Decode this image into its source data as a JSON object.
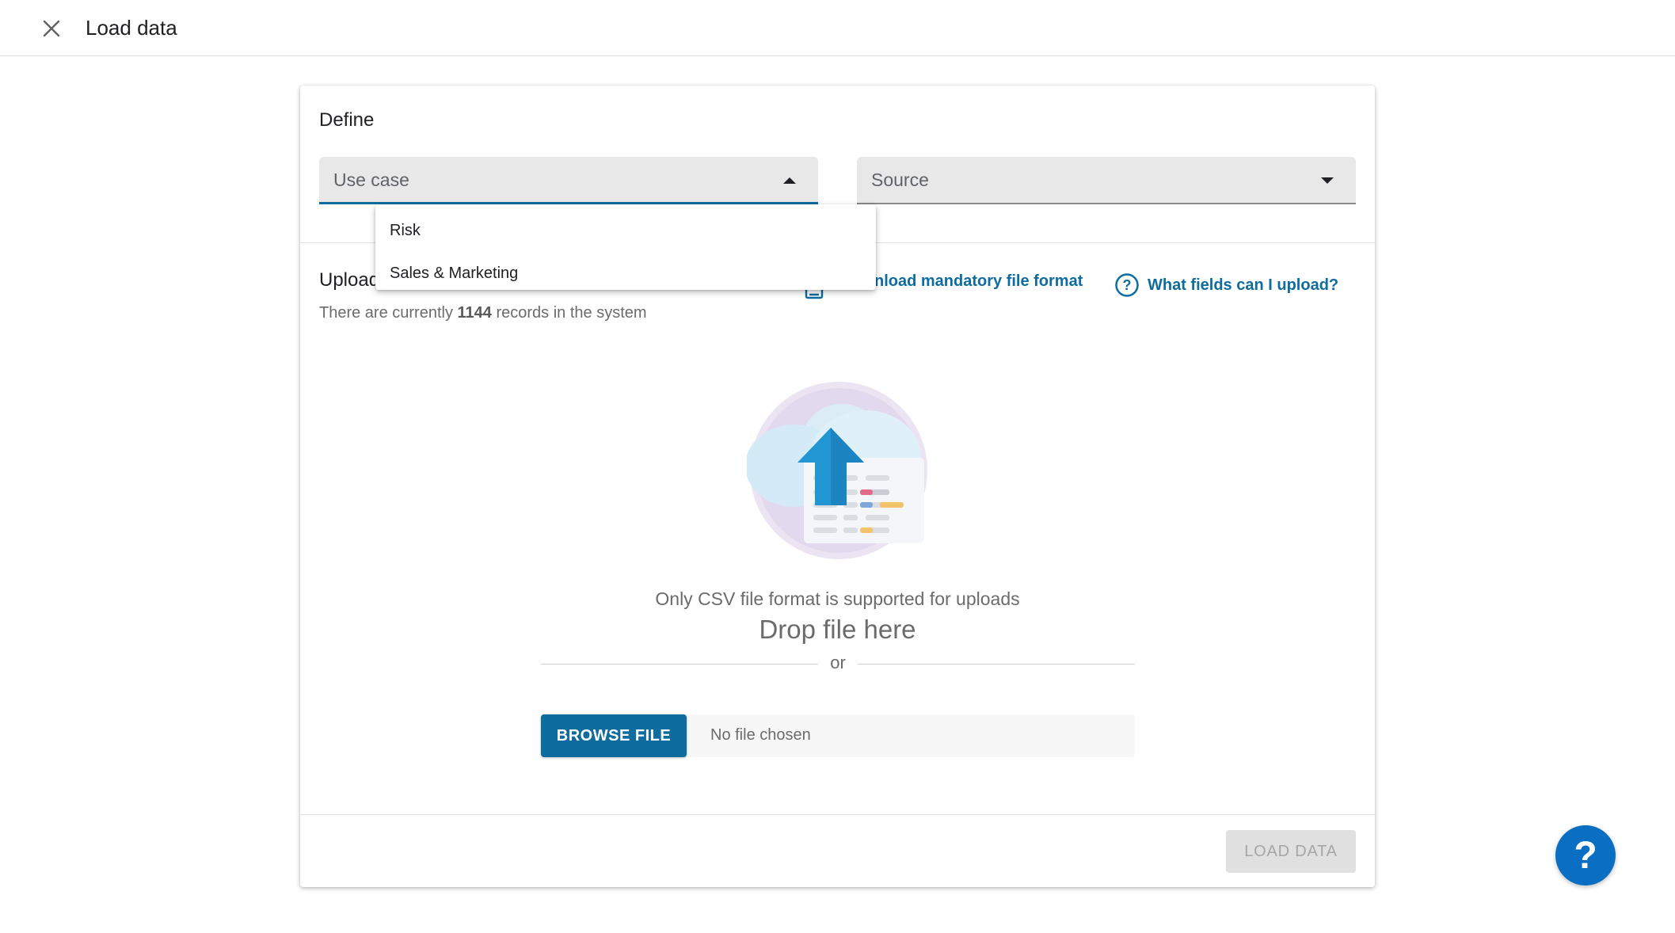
{
  "header": {
    "title": "Load data",
    "close_icon": "close-icon"
  },
  "define": {
    "title": "Define",
    "use_case": {
      "label": "Use case",
      "options": [
        "Risk",
        "Sales & Marketing"
      ]
    },
    "source": {
      "label": "Source"
    }
  },
  "upload": {
    "title": "Upload",
    "records_prefix": "There are currently ",
    "records_count": "1144",
    "records_suffix": " records in the system",
    "download_link": "nload mandatory file format",
    "fields_link": "What fields can I upload?",
    "csv_note": "Only CSV file format is supported for uploads",
    "drop_text": "Drop file here",
    "or_text": "or",
    "browse_label": "BROWSE FILE",
    "no_file": "No file chosen"
  },
  "footer": {
    "load_label": "LOAD DATA"
  },
  "help_fab": {
    "label": "?"
  },
  "colors": {
    "accent": "#0e6c9e",
    "fab": "#0a6fc2"
  }
}
